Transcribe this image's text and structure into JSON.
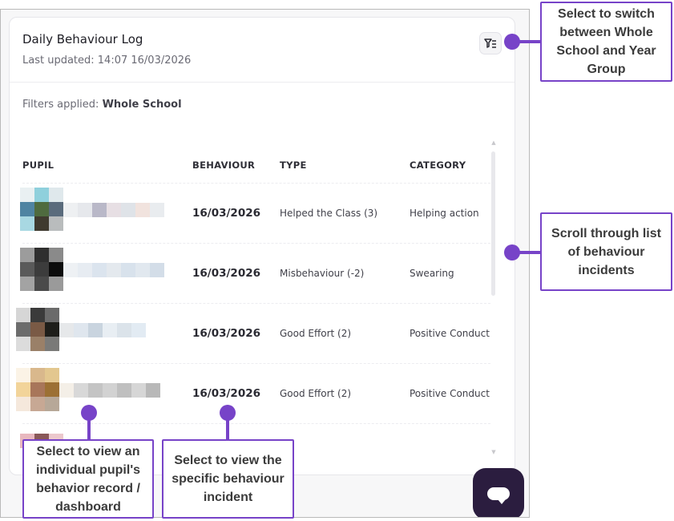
{
  "widget": {
    "title": "Daily Behaviour Log",
    "last_updated": "Last updated: 14:07 16/03/2026",
    "filters_prefix": "Filters applied:",
    "filters_value": "Whole School"
  },
  "table": {
    "headers": [
      "PUPIL",
      "BEHAVIOUR",
      "TYPE",
      "CATEGORY"
    ],
    "rows": [
      {
        "date": "16/03/2026",
        "type": "Helped the Class (3)",
        "category": "Helping action"
      },
      {
        "date": "16/03/2026",
        "type": "Misbehaviour (-2)",
        "category": "Swearing"
      },
      {
        "date": "16/03/2026",
        "type": "Good Effort (2)",
        "category": "Positive Conduct"
      },
      {
        "date": "16/03/2026",
        "type": "Good Effort (2)",
        "category": "Positive Conduct"
      }
    ]
  },
  "callouts": {
    "filter": "Select to switch between Whole School and Year Group",
    "scroll": "Scroll through list of behaviour incidents",
    "pupil": "Select to view an individual pupil's behavior record / dashboard",
    "incident": "Select to view the specific behaviour incident"
  },
  "icons": {
    "filter": "filter-list-icon",
    "chat": "chat-bubble-icon",
    "scroll_up": "chevron-up-icon",
    "scroll_down": "chevron-down-icon"
  },
  "colors": {
    "accent": "#7743c8",
    "chat_button": "#2b1d3f",
    "text_primary": "#1d1d24",
    "text_muted": "#6a6a74"
  }
}
